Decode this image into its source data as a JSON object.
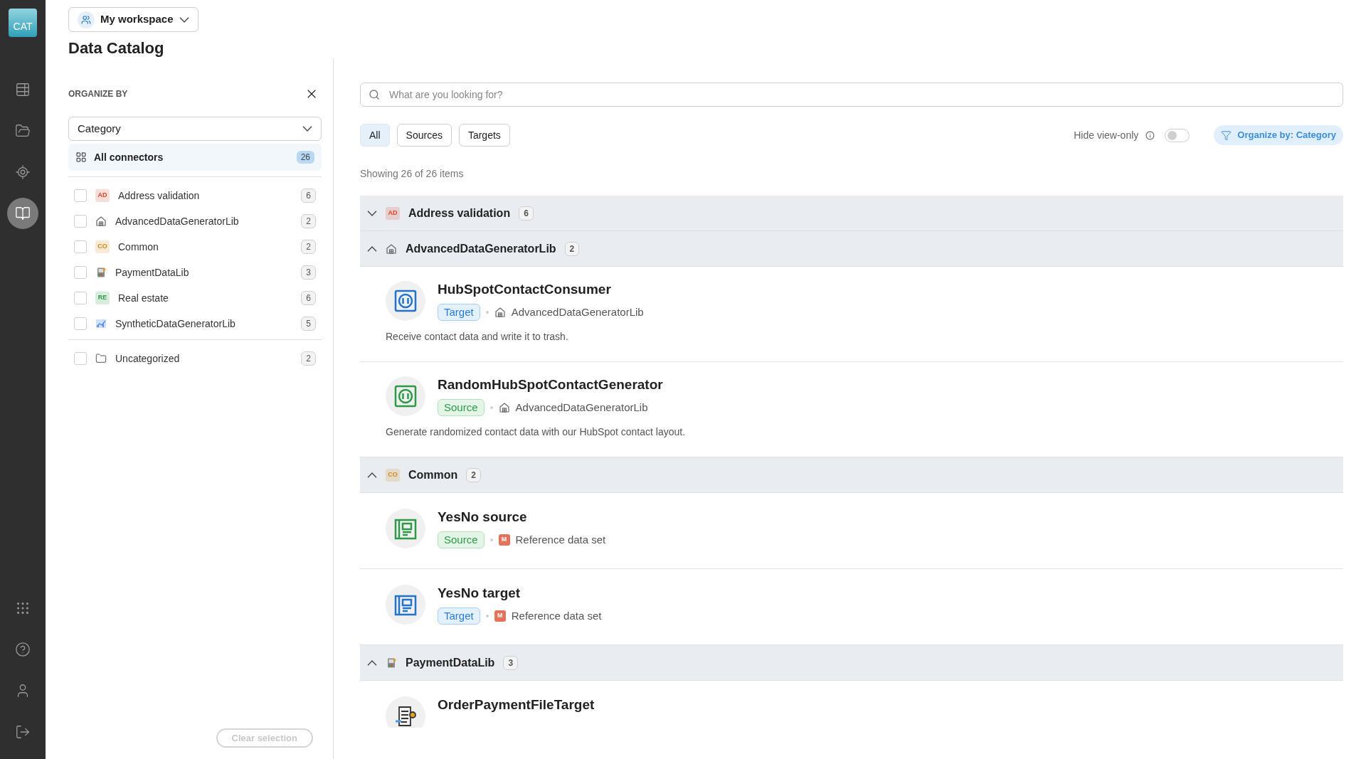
{
  "app_logo": "CAT",
  "nav_rail": [
    {
      "selected": false
    },
    {
      "selected": false
    },
    {
      "selected": false
    },
    {
      "selected": true
    },
    {
      "selected": false
    },
    {
      "selected": false
    },
    {
      "selected": false
    },
    {
      "selected": false
    }
  ],
  "workspace": "My workspace",
  "title": "Data Catalog",
  "organize_panel": {
    "heading": "ORGANIZE BY",
    "select_value": "Category",
    "all_item": {
      "label": "All connectors",
      "count": "26",
      "selected": true
    },
    "categories": [
      {
        "label": "Address validation",
        "count": "6",
        "checked": false,
        "kind": "letters",
        "letters": "AD",
        "color": "#d9472b"
      },
      {
        "label": "AdvancedDataGeneratorLib",
        "count": "2",
        "checked": false,
        "kind": "library"
      },
      {
        "label": "Common",
        "count": "2",
        "checked": false,
        "kind": "letters",
        "letters": "CO",
        "color": "#d08a1c"
      },
      {
        "label": "PaymentDataLib",
        "count": "3",
        "checked": false,
        "kind": "payment"
      },
      {
        "label": "Real estate",
        "count": "6",
        "checked": false,
        "kind": "letters",
        "letters": "RE",
        "color": "#2e9a47"
      },
      {
        "label": "SyntheticDataGeneratorLib",
        "count": "5",
        "checked": false,
        "kind": "synthetic"
      }
    ],
    "uncategorized": {
      "label": "Uncategorized",
      "count": "2",
      "checked": false
    },
    "clear_button": {
      "label": "Clear selection",
      "disabled": true
    }
  },
  "search": {
    "placeholder": "What are you looking for?"
  },
  "filters": [
    {
      "label": "All",
      "selected": true
    },
    {
      "label": "Sources",
      "selected": false
    },
    {
      "label": "Targets",
      "selected": false
    }
  ],
  "hide_view_only": {
    "label": "Hide view-only",
    "on": false
  },
  "organize_button": "Organize by: Category",
  "showing": "Showing 26 of 26 items",
  "groups": [
    {
      "name": "Address validation",
      "count": "6",
      "expanded": false,
      "kind": "letters",
      "letters": "AD",
      "color": "#d9472b"
    },
    {
      "name": "AdvancedDataGeneratorLib",
      "count": "2",
      "expanded": true,
      "kind": "library",
      "items": [
        {
          "title": "HubSpotContactConsumer",
          "kind": "connector",
          "is_source": false,
          "role_label": "Target",
          "origin": {
            "label": "AdvancedDataGeneratorLib",
            "kind": "library"
          },
          "description": "Receive contact data and write it to trash."
        },
        {
          "title": "RandomHubSpotContactGenerator",
          "kind": "connector",
          "is_source": true,
          "role_label": "Source",
          "origin": {
            "label": "AdvancedDataGeneratorLib",
            "kind": "library"
          },
          "description": "Generate randomized contact data with our HubSpot contact layout."
        }
      ]
    },
    {
      "name": "Common",
      "count": "2",
      "expanded": true,
      "kind": "letters",
      "letters": "CO",
      "color": "#d08a1c",
      "items": [
        {
          "title": "YesNo source",
          "kind": "dataset",
          "is_source": true,
          "role_label": "Source",
          "origin": {
            "label": "Reference data set",
            "kind": "letter",
            "letter": "M"
          }
        },
        {
          "title": "YesNo target",
          "kind": "dataset",
          "is_source": false,
          "role_label": "Target",
          "origin": {
            "label": "Reference data set",
            "kind": "letter",
            "letter": "M"
          }
        }
      ]
    },
    {
      "name": "PaymentDataLib",
      "count": "3",
      "expanded": true,
      "kind": "payment",
      "items": [
        {
          "title": "OrderPaymentFileTarget",
          "kind": "file"
        }
      ]
    }
  ]
}
